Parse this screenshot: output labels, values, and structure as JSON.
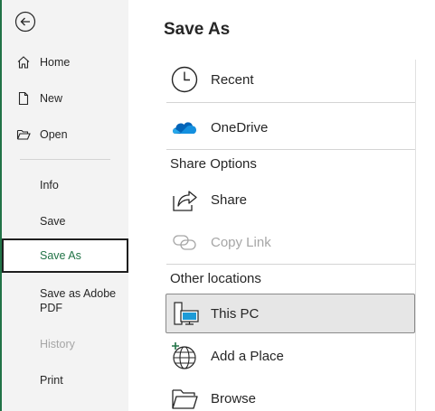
{
  "sidebar": {
    "back_label": "Back",
    "items": [
      {
        "label": "Home",
        "icon": "home-icon"
      },
      {
        "label": "New",
        "icon": "new-document-icon"
      },
      {
        "label": "Open",
        "icon": "folder-open-icon"
      },
      {
        "label": "Info"
      },
      {
        "label": "Save"
      },
      {
        "label": "Save As",
        "selected": true
      },
      {
        "label": "Save as Adobe PDF"
      },
      {
        "label": "History",
        "disabled": true
      },
      {
        "label": "Print"
      }
    ]
  },
  "main": {
    "title": "Save As",
    "locations_top": [
      {
        "label": "Recent",
        "icon": "clock-icon"
      },
      {
        "label": "OneDrive",
        "icon": "onedrive-cloud-icon"
      }
    ],
    "share_heading": "Share Options",
    "share_items": [
      {
        "label": "Share",
        "icon": "share-icon"
      },
      {
        "label": "Copy Link",
        "icon": "link-icon",
        "disabled": true
      }
    ],
    "other_heading": "Other locations",
    "other_items": [
      {
        "label": "This PC",
        "icon": "computer-icon",
        "selected": true
      },
      {
        "label": "Add a Place",
        "icon": "globe-add-icon"
      },
      {
        "label": "Browse",
        "icon": "folder-icon"
      }
    ]
  },
  "colors": {
    "accent": "#217346",
    "sidebar_bg": "#f3f3f3",
    "selected_bg": "#e6e6e6",
    "onedrive": "#0364b8"
  }
}
